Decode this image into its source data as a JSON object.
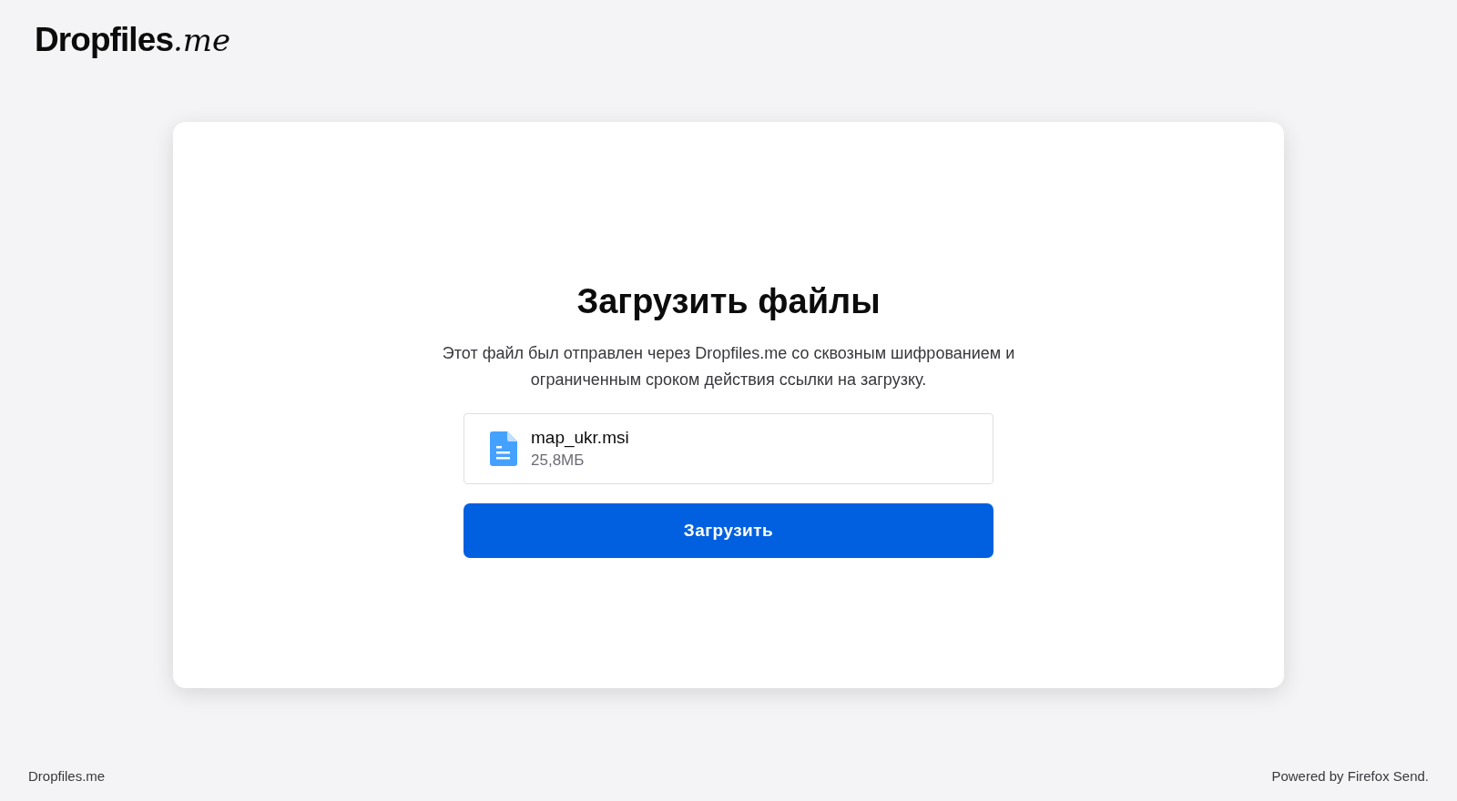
{
  "header": {
    "logo": {
      "name": "Dropfiles",
      "suffix": ".me"
    }
  },
  "card": {
    "title": "Загрузить файлы",
    "description": "Этот файл был отправлен через Dropfiles.me со сквозным шифрованием и ограниченным сроком действия ссылки на загрузку.",
    "file": {
      "name": "map_ukr.msi",
      "size": "25,8МБ"
    },
    "button": "Загрузить"
  },
  "footer": {
    "left": "Dropfiles.me",
    "right": "Powered by Firefox Send."
  }
}
